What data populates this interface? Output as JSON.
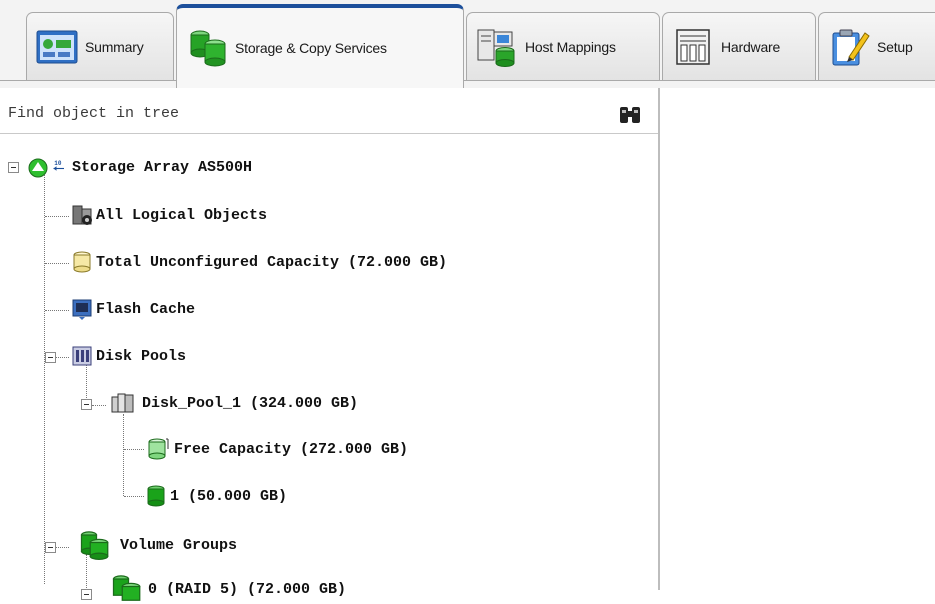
{
  "tabs": [
    {
      "label": "Summary",
      "icon": "summary-icon",
      "active": false
    },
    {
      "label": "Storage & Copy Services",
      "icon": "storage-cylinders-icon",
      "active": true
    },
    {
      "label": "Host Mappings",
      "icon": "host-mappings-icon",
      "active": false
    },
    {
      "label": "Hardware",
      "icon": "hardware-icon",
      "active": false
    },
    {
      "label": "Setup",
      "icon": "setup-clipboard-icon",
      "active": false
    }
  ],
  "find": {
    "placeholder": "Find object in tree"
  },
  "tree": {
    "root": {
      "label": "Storage Array AS500H",
      "icon": "storage-array-status-icon"
    },
    "all_logical": {
      "label": "All Logical Objects",
      "icon": "logical-objects-icon"
    },
    "unconfigured": {
      "label": "Total Unconfigured Capacity (72.000 GB)",
      "icon": "unconfigured-capacity-icon"
    },
    "flash_cache": {
      "label": "Flash Cache",
      "icon": "flash-cache-icon"
    },
    "disk_pools": {
      "label": "Disk Pools",
      "icon": "disk-pools-icon"
    },
    "disk_pool_1": {
      "label": "Disk_Pool_1 (324.000 GB)",
      "icon": "disk-pool-icon"
    },
    "free_capacity": {
      "label": "Free Capacity (272.000 GB)",
      "icon": "free-capacity-icon"
    },
    "volume_1": {
      "label": "1 (50.000 GB)",
      "icon": "volume-icon"
    },
    "volume_groups": {
      "label": "Volume Groups",
      "icon": "volume-groups-icon"
    },
    "volume_group_0": {
      "label": "0 (RAID 5) (72.000 GB)",
      "icon": "volume-group-icon"
    }
  },
  "colors": {
    "active_tab_accent": "#1c4f9b",
    "volume_green": "#1aa31a",
    "status_green": "#2fbf2f"
  }
}
